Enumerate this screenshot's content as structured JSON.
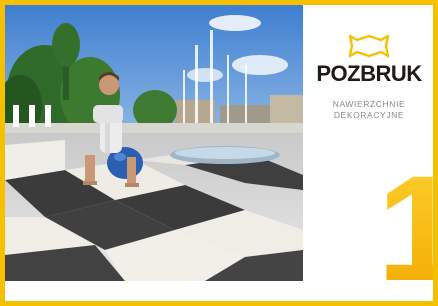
{
  "colors": {
    "frame": "#f5c000",
    "number_top": "#fcd02e",
    "number_bottom": "#f3aa00",
    "brand_text": "#1f1a17",
    "tagline_text": "#8a8a8a"
  },
  "photo": {
    "subject": "boy-on-bouncing-ball-on-checkered-paving"
  },
  "brand": {
    "icon": "logo-outline-icon",
    "name": "POZBRUK",
    "tagline_line1": "NAWIERZCHNIE",
    "tagline_line2": "DEKORACYJNE"
  },
  "number": "1"
}
